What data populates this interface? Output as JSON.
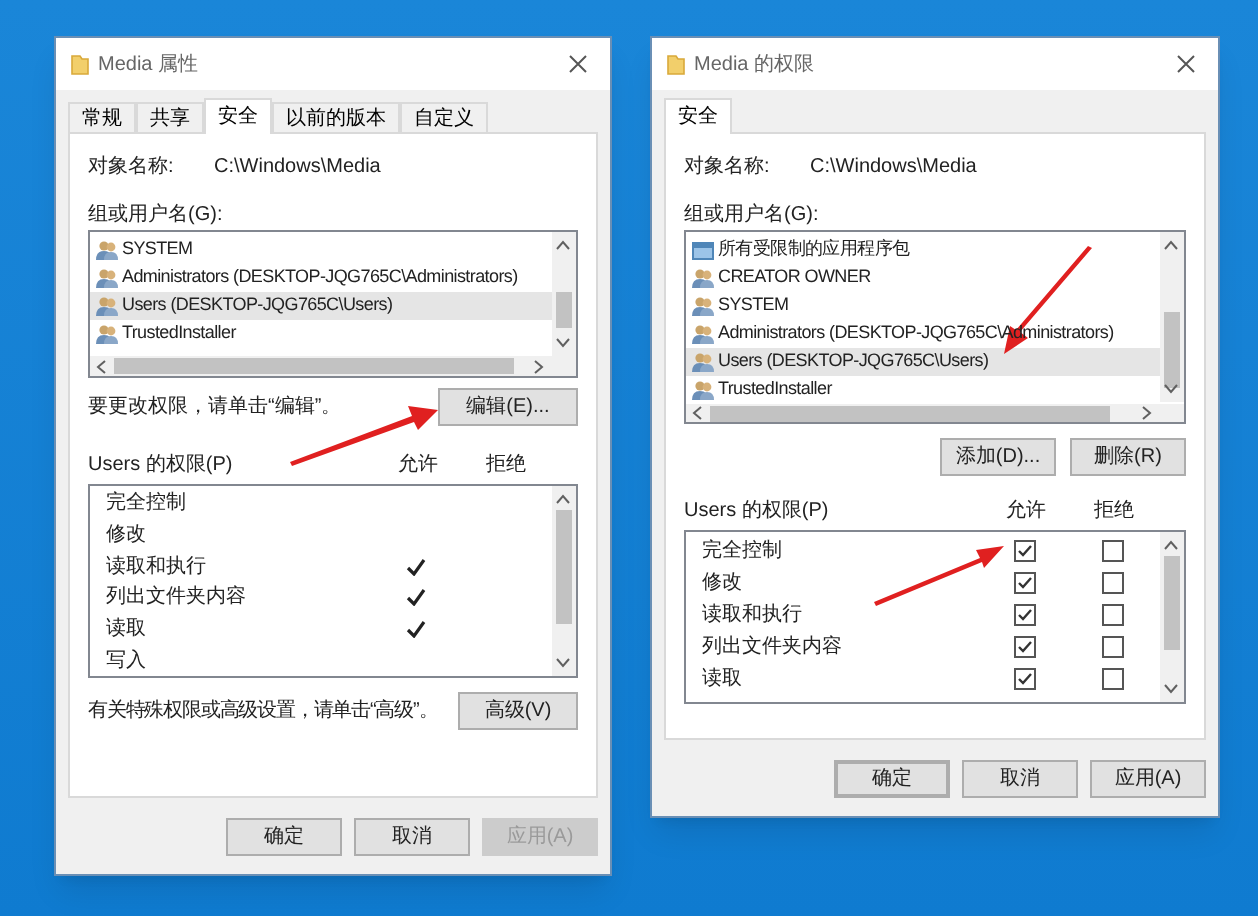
{
  "windows": [
    {
      "title": "Media 属性",
      "tabs": [
        {
          "label": "常规",
          "selected": false
        },
        {
          "label": "共享",
          "selected": false
        },
        {
          "label": "安全",
          "selected": true
        },
        {
          "label": "以前的版本",
          "selected": false
        },
        {
          "label": "自定义",
          "selected": false
        }
      ],
      "object_label": "对象名称:",
      "object_value": "C:\\Windows\\Media",
      "group_label": "组或用户名(G):",
      "users": [
        {
          "name": "SYSTEM",
          "kind": "group",
          "selected": false
        },
        {
          "name": "Administrators (DESKTOP-JQG765C\\Administrators)",
          "kind": "group",
          "selected": false
        },
        {
          "name": "Users (DESKTOP-JQG765C\\Users)",
          "kind": "group",
          "selected": true
        },
        {
          "name": "TrustedInstaller",
          "kind": "group",
          "selected": false
        }
      ],
      "edit_hint": "要更改权限，请单击“编辑”。",
      "edit_button": "编辑(E)...",
      "perm_label": "Users 的权限(P)",
      "allow_header": "允许",
      "deny_header": "拒绝",
      "kind": "ticks",
      "permissions": [
        {
          "name": "完全控制",
          "allow": false,
          "deny": false
        },
        {
          "name": "修改",
          "allow": false,
          "deny": false
        },
        {
          "name": "读取和执行",
          "allow": true,
          "deny": false
        },
        {
          "name": "列出文件夹内容",
          "allow": true,
          "deny": false
        },
        {
          "name": "读取",
          "allow": true,
          "deny": false
        },
        {
          "name": "写入",
          "allow": false,
          "deny": false
        }
      ],
      "advanced_hint": "有关特殊权限或高级设置，请单击“高级”。",
      "advanced_button": "高级(V)",
      "buttons": [
        {
          "label": "确定",
          "disabled": false,
          "default": false
        },
        {
          "label": "取消",
          "disabled": false,
          "default": false
        },
        {
          "label": "应用(A)",
          "disabled": true,
          "default": false
        }
      ]
    },
    {
      "title": "Media 的权限",
      "tabs": [
        {
          "label": "安全",
          "selected": true
        }
      ],
      "object_label": "对象名称:",
      "object_value": "C:\\Windows\\Media",
      "group_label": "组或用户名(G):",
      "users": [
        {
          "name": "所有受限制的应用程序包",
          "kind": "package",
          "selected": false
        },
        {
          "name": "CREATOR OWNER",
          "kind": "group",
          "selected": false
        },
        {
          "name": "SYSTEM",
          "kind": "group",
          "selected": false
        },
        {
          "name": "Administrators (DESKTOP-JQG765C\\Administrators)",
          "kind": "group",
          "selected": false
        },
        {
          "name": "Users (DESKTOP-JQG765C\\Users)",
          "kind": "group",
          "selected": true
        },
        {
          "name": "TrustedInstaller",
          "kind": "group",
          "selected": false
        }
      ],
      "list_buttons": [
        "添加(D)...",
        "删除(R)"
      ],
      "perm_label": "Users 的权限(P)",
      "allow_header": "允许",
      "deny_header": "拒绝",
      "kind": "checkboxes",
      "permissions": [
        {
          "name": "完全控制",
          "allow": true,
          "deny": false
        },
        {
          "name": "修改",
          "allow": true,
          "deny": false
        },
        {
          "name": "读取和执行",
          "allow": true,
          "deny": false
        },
        {
          "name": "列出文件夹内容",
          "allow": true,
          "deny": false
        },
        {
          "name": "读取",
          "allow": true,
          "deny": false
        }
      ],
      "buttons": [
        {
          "label": "确定",
          "disabled": false,
          "default": true
        },
        {
          "label": "取消",
          "disabled": false,
          "default": false
        },
        {
          "label": "应用(A)",
          "disabled": false,
          "default": false
        }
      ]
    }
  ]
}
